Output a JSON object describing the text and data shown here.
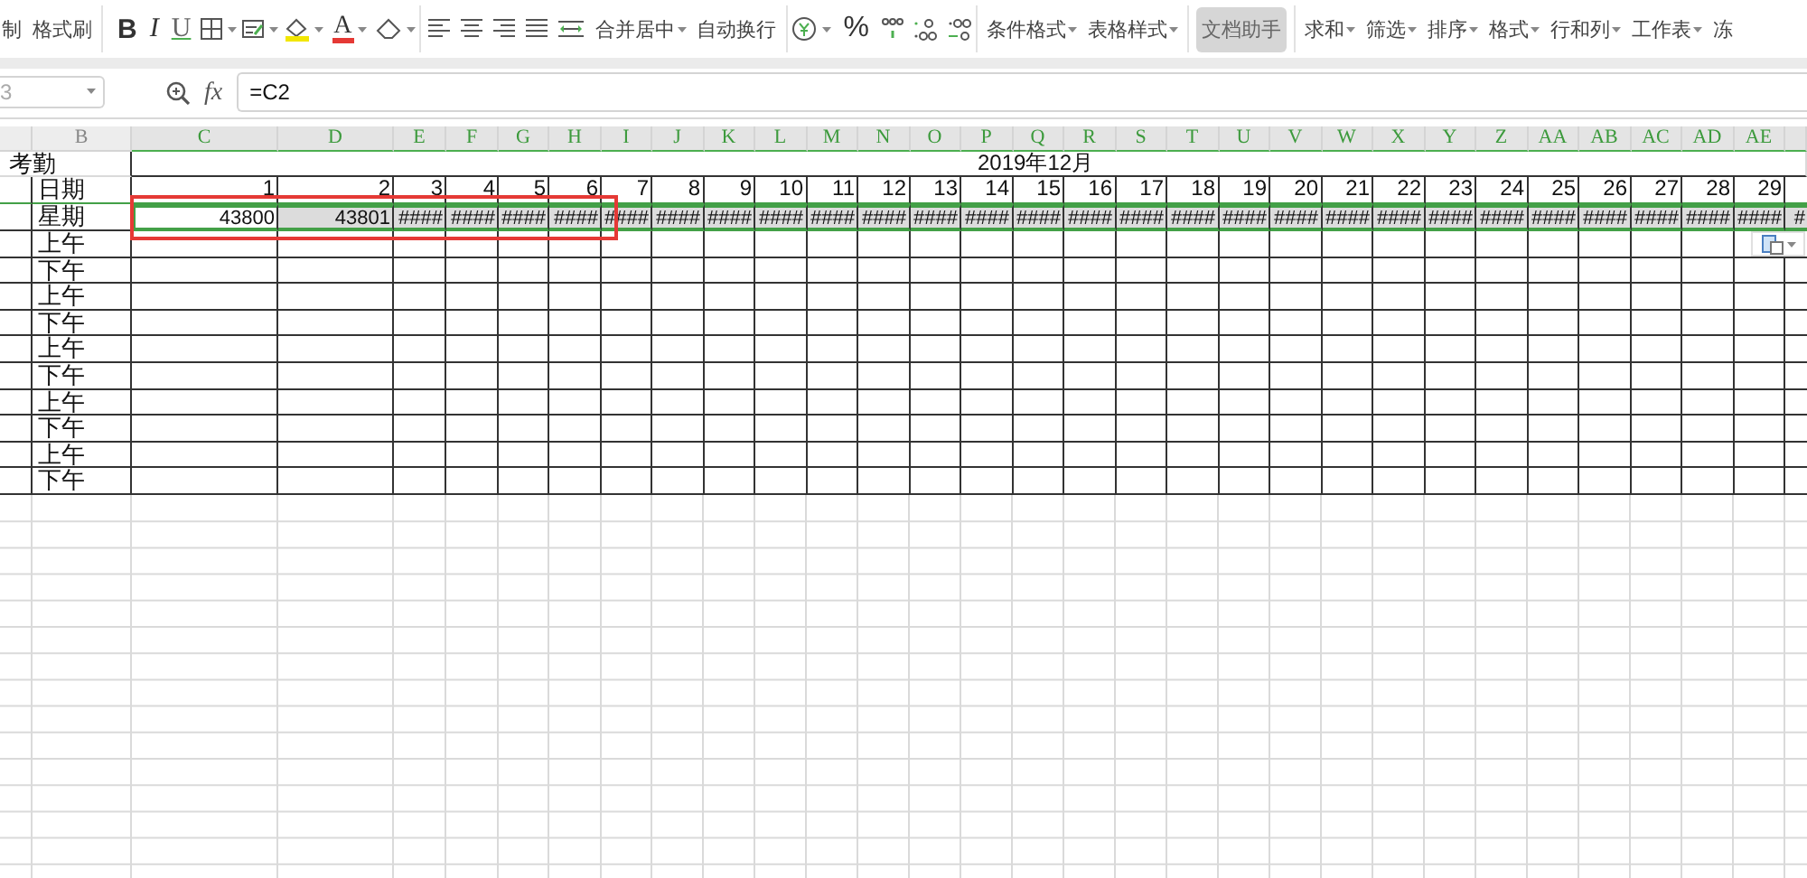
{
  "ribbon": {
    "items": [
      {
        "kind": "button",
        "label": "制",
        "dropdown": false,
        "selected": false
      },
      {
        "kind": "button",
        "label": "格式刷",
        "dropdown": false,
        "selected": false
      },
      {
        "kind": "separator"
      },
      {
        "kind": "font-tools",
        "bold": "B",
        "italic": "I",
        "underline": "U",
        "font_color": "A"
      },
      {
        "kind": "separator"
      },
      {
        "kind": "align-tools"
      },
      {
        "kind": "button",
        "label": "合并居中",
        "dropdown": true,
        "selected": false
      },
      {
        "kind": "button",
        "label": "自动换行",
        "dropdown": false,
        "selected": false
      },
      {
        "kind": "separator"
      },
      {
        "kind": "number-tools",
        "percent": "%"
      },
      {
        "kind": "separator"
      },
      {
        "kind": "button",
        "label": "条件格式",
        "dropdown": true,
        "selected": false
      },
      {
        "kind": "button",
        "label": "表格样式",
        "dropdown": true,
        "selected": false
      },
      {
        "kind": "separator"
      },
      {
        "kind": "button",
        "label": "文档助手",
        "dropdown": false,
        "selected": true
      },
      {
        "kind": "separator"
      },
      {
        "kind": "button",
        "label": "求和",
        "dropdown": true,
        "selected": false
      },
      {
        "kind": "button",
        "label": "筛选",
        "dropdown": true,
        "selected": false
      },
      {
        "kind": "button",
        "label": "排序",
        "dropdown": true,
        "selected": false
      },
      {
        "kind": "button",
        "label": "格式",
        "dropdown": true,
        "selected": false
      },
      {
        "kind": "button",
        "label": "行和列",
        "dropdown": true,
        "selected": false
      },
      {
        "kind": "button",
        "label": "工作表",
        "dropdown": true,
        "selected": false
      },
      {
        "kind": "button",
        "label": "冻",
        "dropdown": false,
        "selected": false
      }
    ]
  },
  "name_box": {
    "value": "3"
  },
  "formula_bar": {
    "fx_label": "fx",
    "value": "=C2"
  },
  "sheet": {
    "columns": [
      {
        "label": "B",
        "selected": false
      },
      {
        "label": "C",
        "selected": true
      },
      {
        "label": "D",
        "selected": true
      },
      {
        "label": "E",
        "selected": true
      },
      {
        "label": "F",
        "selected": true
      },
      {
        "label": "G",
        "selected": true
      },
      {
        "label": "H",
        "selected": true
      },
      {
        "label": "I",
        "selected": true
      },
      {
        "label": "J",
        "selected": true
      },
      {
        "label": "K",
        "selected": true
      },
      {
        "label": "L",
        "selected": true
      },
      {
        "label": "M",
        "selected": true
      },
      {
        "label": "N",
        "selected": true
      },
      {
        "label": "O",
        "selected": true
      },
      {
        "label": "P",
        "selected": true
      },
      {
        "label": "Q",
        "selected": true
      },
      {
        "label": "R",
        "selected": true
      },
      {
        "label": "S",
        "selected": true
      },
      {
        "label": "T",
        "selected": true
      },
      {
        "label": "U",
        "selected": true
      },
      {
        "label": "V",
        "selected": true
      },
      {
        "label": "W",
        "selected": true
      },
      {
        "label": "X",
        "selected": true
      },
      {
        "label": "Y",
        "selected": true
      },
      {
        "label": "Z",
        "selected": true
      },
      {
        "label": "AA",
        "selected": true
      },
      {
        "label": "AB",
        "selected": true
      },
      {
        "label": "AC",
        "selected": true
      },
      {
        "label": "AD",
        "selected": true
      },
      {
        "label": "AE",
        "selected": true
      }
    ],
    "title_row": {
      "label": "考勤",
      "month": "2019年12月"
    },
    "rows": [
      {
        "label": "日期",
        "selected": false,
        "values": [
          "1",
          "2",
          "3",
          "4",
          "5",
          "6",
          "7",
          "8",
          "9",
          "10",
          "11",
          "12",
          "13",
          "14",
          "15",
          "16",
          "17",
          "18",
          "19",
          "20",
          "21",
          "22",
          "23",
          "24",
          "25",
          "26",
          "27",
          "28",
          "29"
        ]
      },
      {
        "label": "星期",
        "selected": true,
        "values": [
          "43800",
          "43801",
          "####",
          "####",
          "####",
          "####",
          "####",
          "####",
          "####",
          "####",
          "####",
          "####",
          "####",
          "####",
          "####",
          "####",
          "####",
          "####",
          "####",
          "####",
          "####",
          "####",
          "####",
          "####",
          "####",
          "####",
          "####",
          "####",
          "####",
          "#"
        ]
      },
      {
        "label": "上午",
        "selected": false,
        "values": []
      },
      {
        "label": "下午",
        "selected": false,
        "values": []
      },
      {
        "label": "上午",
        "selected": false,
        "values": []
      },
      {
        "label": "下午",
        "selected": false,
        "values": []
      },
      {
        "label": "上午",
        "selected": false,
        "values": []
      },
      {
        "label": "下午",
        "selected": false,
        "values": []
      },
      {
        "label": "上午",
        "selected": false,
        "values": []
      },
      {
        "label": "下午",
        "selected": false,
        "values": []
      },
      {
        "label": "上午",
        "selected": false,
        "values": []
      },
      {
        "label": "下午",
        "selected": false,
        "values": []
      }
    ]
  }
}
